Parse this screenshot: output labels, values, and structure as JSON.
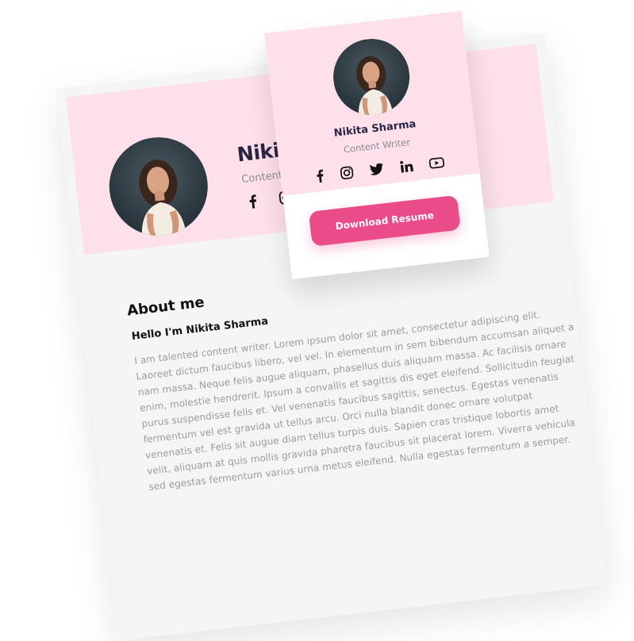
{
  "profile": {
    "name": "Nikita Sharma",
    "role": "Content Writer",
    "name_partial": "Nikita Sh"
  },
  "social": {
    "back_icons": [
      "facebook-icon",
      "instagram-icon",
      "twitter-icon"
    ],
    "front_icons": [
      "facebook-icon",
      "instagram-icon",
      "twitter-icon",
      "linkedin-icon",
      "youtube-icon"
    ]
  },
  "actions": {
    "download_label": "Download Resume"
  },
  "about": {
    "title": "About me",
    "greeting": "Hello I'm Nikita Sharma",
    "bio": "I am talented content writer. Lorem ipsum dolor sit amet, consectetur adipiscing elit. Laoreet dictum faucibus libero, vel vel. In elementum in sem bibendum accumsan aliquet a nam massa. Neque felis augue aliquam, phasellus duis aliquam massa. Ac facilisis ornare enim, molestie hendrerit. Ipsum a convallis et sagittis dis eget eleifend. Sollicitudin feugiat purus suspendisse felis et. Vel venenatis faucibus sagittis, senectus. Egestas venenatis fermentum vel est gravida ut tellus arcu. Orci nulla blandit donec ornare volutpat venenatis et. Felis sit augue diam tellus turpis duis. Sapien cras tristique lobortis amet velit, aliquam at quis mollis gravida pharetra faucibus sit placerat lorem. Viverra vehicula sed egestas fermentum varius urna metus eleifend. Nulla egestas fermentum a semper."
  },
  "colors": {
    "pink_bg": "#fde0ea",
    "accent": "#ea4c89",
    "name_text": "#2a2547",
    "muted_text": "#8d8a96",
    "card_bg": "#f5f5f5"
  }
}
